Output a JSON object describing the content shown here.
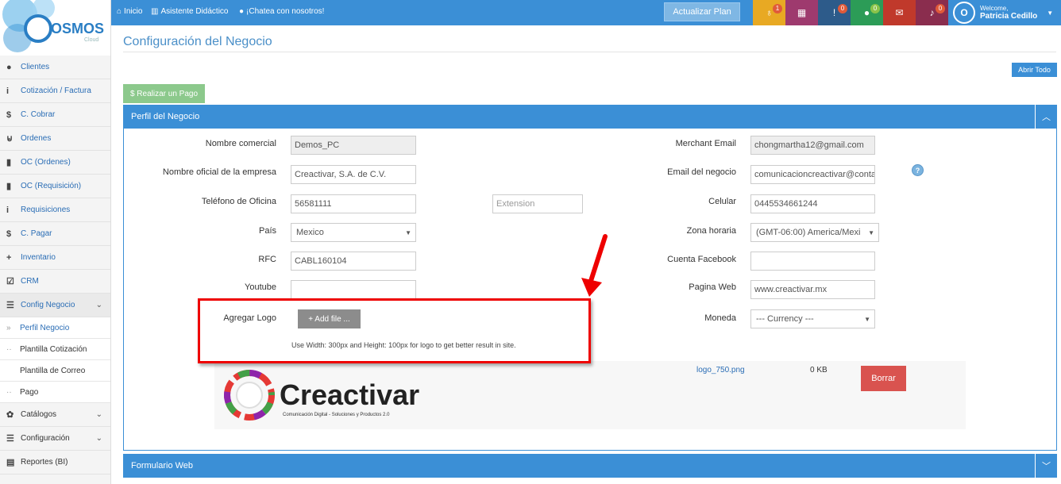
{
  "brand": {
    "logo_text": "OSMOS",
    "logo_sub": "Cloud"
  },
  "topbar": {
    "nav": [
      {
        "icon": "home-icon",
        "label": "Inicio"
      },
      {
        "icon": "book-icon",
        "label": "Asistente Didáctico"
      },
      {
        "icon": "chat-icon",
        "label": "¡Chatea con nosotros!"
      }
    ],
    "plan_button": "Actualizar Plan",
    "badges": {
      "bulb": "1",
      "alert": "0",
      "chat": "0",
      "bell": "0"
    },
    "colors": {
      "bulb": "#e8a923",
      "calendar": "#9e3a6e",
      "alert": "#2d5b8a",
      "chat": "#2c9c57",
      "mail": "#c0392b",
      "bell": "#8a2d4e"
    },
    "user_welcome": "Welcome,",
    "user_name": "Patricia Cedillo",
    "avatar": "O"
  },
  "sidebar": {
    "items": [
      {
        "icon": "user-icon",
        "label": "Clientes"
      },
      {
        "icon": "info-icon",
        "label": "Cotización / Factura"
      },
      {
        "icon": "dollar-icon",
        "label": "C. Cobrar"
      },
      {
        "icon": "cart-icon",
        "label": "Ordenes"
      },
      {
        "icon": "file-icon",
        "label": "OC (Ordenes)"
      },
      {
        "icon": "file-icon",
        "label": "OC (Requisición)"
      },
      {
        "icon": "info-icon",
        "label": "Requisiciones"
      },
      {
        "icon": "dollar-icon",
        "label": "C. Pagar"
      },
      {
        "icon": "plus-icon",
        "label": "Inventario"
      },
      {
        "icon": "check-icon",
        "label": "CRM"
      },
      {
        "icon": "list-icon",
        "label": "Config Negocio"
      }
    ],
    "sub_items": [
      "Perfil Negocio",
      "Plantilla Cotización",
      "Plantilla de Correo",
      "Pago"
    ],
    "bottom": [
      {
        "icon": "palette-icon",
        "label": "Catálogos"
      },
      {
        "icon": "list-icon",
        "label": "Configuración"
      },
      {
        "icon": "chart-icon",
        "label": "Reportes (BI)"
      }
    ]
  },
  "main": {
    "title": "Configuración del Negocio",
    "abrir_todo": "Abrir Todo",
    "pago_button": "$ Realizar un Pago",
    "panel_title": "Perfil del Negocio",
    "panel2_title": "Formulario Web",
    "form": {
      "nombre_comercial": {
        "label": "Nombre comercial",
        "value": "Demos_PC"
      },
      "nombre_oficial": {
        "label": "Nombre oficial de la empresa",
        "value": "Creactivar, S.A. de C.V."
      },
      "telefono": {
        "label": "Teléfono de Oficina",
        "value": "56581111"
      },
      "extension": {
        "placeholder": "Extension"
      },
      "pais": {
        "label": "País",
        "value": "Mexico"
      },
      "rfc": {
        "label": "RFC",
        "value": "CABL160104"
      },
      "youtube": {
        "label": "Youtube",
        "value": ""
      },
      "merchant": {
        "label": "Merchant Email",
        "value": "chongmartha12@gmail.com"
      },
      "email_negocio": {
        "label": "Email del negocio",
        "value": "comunicacioncreactivar@conta"
      },
      "celular": {
        "label": "Celular",
        "value": "0445534661244"
      },
      "zona": {
        "label": "Zona horaria",
        "value": "(GMT-06:00) America/Mexi"
      },
      "facebook": {
        "label": "Cuenta Facebook",
        "value": ""
      },
      "web": {
        "label": "Pagina Web",
        "value": "www.creactivar.mx"
      },
      "moneda": {
        "label": "Moneda",
        "value": "--- Currency ---"
      },
      "logo": {
        "label": "Agregar Logo",
        "button": "+ Add file ...",
        "hint": "Use Width: 300px and Height: 100px for logo to get better result in site."
      }
    },
    "file": {
      "name": "logo_750.png",
      "size": "0 KB",
      "delete": "Borrar",
      "logo_word": "Creactivar",
      "logo_tagline": "Comunicación Digital - Soluciones y Productos 2.0"
    }
  }
}
